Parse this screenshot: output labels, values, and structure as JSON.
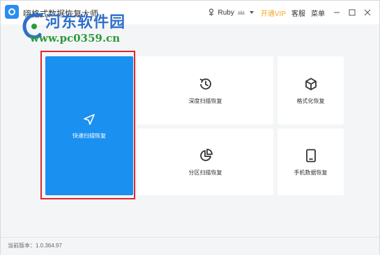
{
  "window": {
    "title": "嗨格式数据恢复大师",
    "user_name": "Ruby",
    "vip_label": "开通VIP",
    "service_label": "客服",
    "menu_label": "菜单"
  },
  "watermark": {
    "site_name": "河东软件园",
    "site_url": "www.pc0359.cn"
  },
  "cards": {
    "quick_scan": "快速扫描恢复",
    "deep_scan": "深度扫描恢复",
    "format_recovery": "格式化恢复",
    "partition_scan": "分区扫描恢复",
    "phone_recovery": "手机数据恢复"
  },
  "footer": {
    "version_text": "当前版本：1.0.364.97"
  },
  "colors": {
    "accent": "#1a90f0",
    "highlight": "#e0262d",
    "vip": "#f5a623",
    "icon": "#333333"
  },
  "icons": [
    "app-logo-icon",
    "avatar-icon",
    "crown-icon",
    "dropdown-arrow-icon",
    "minimize-icon",
    "maximize-icon",
    "close-icon",
    "send-arrow-icon",
    "history-clock-icon",
    "cube-icon",
    "pie-chart-icon",
    "tablet-icon"
  ]
}
